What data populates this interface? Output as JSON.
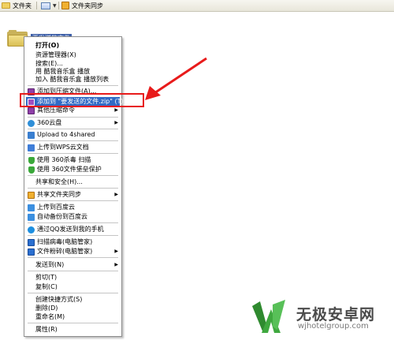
{
  "toolbar": {
    "folders_label": "文件夹",
    "sync_label": "文件夹同步"
  },
  "desktop": {
    "selected_file_label": "要发送的文件"
  },
  "context_menu": {
    "open": "打开(O)",
    "explorer": "资源管理器(X)",
    "search": "搜索(E)...",
    "play_kugou": "用 酷我音乐盒 播放",
    "add_kugou_playlist": "加入 酷我音乐盒 播放列表",
    "add_to_archive": "添加到压缩文件(A)...",
    "add_to_named_zip": "添加到 \"要发送的文件.zip\" (T)",
    "other_compress": "其他压缩命令",
    "cloud360": "360云盘",
    "upload_4shared": "Upload to 4shared",
    "upload_wps": "上传到WPS云文档",
    "scan_360": "使用 360杀毒 扫描",
    "shred_360": "使用 360文件堡垒保护",
    "share_security": "共享和安全(H)...",
    "sync_shared": "共享文件夹同步",
    "upload_baidu": "上传到百度云",
    "backup_baidu": "自动备份到百度云",
    "send_qq_phone": "通过QQ发送到我的手机",
    "pcmgr_scan": "扫描病毒(电脑管家)",
    "pcmgr_shred": "文件粉碎(电脑管家)",
    "send_to": "发送到(N)",
    "cut": "剪切(T)",
    "copy": "复制(C)",
    "create_shortcut": "创建快捷方式(S)",
    "delete": "删除(D)",
    "rename": "重命名(M)",
    "properties": "属性(R)"
  },
  "watermark": {
    "title": "无极安卓网",
    "url": "wjhotelgroup.com"
  },
  "colors": {
    "highlight": "#316ac5",
    "annotation_red": "#e81b1b",
    "watermark_green": "#3a9a3a"
  }
}
